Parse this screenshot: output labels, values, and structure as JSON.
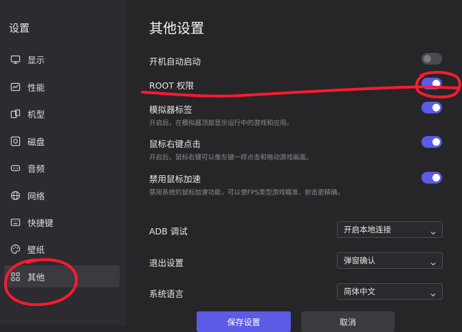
{
  "sidebar": {
    "title": "设置",
    "items": [
      {
        "label": "显示",
        "icon": "monitor-icon"
      },
      {
        "label": "性能",
        "icon": "performance-icon"
      },
      {
        "label": "机型",
        "icon": "device-icon"
      },
      {
        "label": "磁盘",
        "icon": "disk-icon"
      },
      {
        "label": "音频",
        "icon": "audio-icon"
      },
      {
        "label": "网络",
        "icon": "globe-icon"
      },
      {
        "label": "快捷键",
        "icon": "keyboard-icon"
      },
      {
        "label": "壁纸",
        "icon": "palette-icon"
      },
      {
        "label": "其他",
        "icon": "grid-icon"
      }
    ],
    "active_index": 8
  },
  "main": {
    "title": "其他设置",
    "toggles": [
      {
        "title": "开机自动启动",
        "desc": "",
        "on": false
      },
      {
        "title": "ROOT 权限",
        "desc": "",
        "on": true
      },
      {
        "title": "模拟器标签",
        "desc": "开启后，在模拟器顶部显示运行中的游戏和应用。",
        "on": true
      },
      {
        "title": "鼠标右键点击",
        "desc": "开启后，鼠标右键可以像左键一样点击和拖动游戏画面。",
        "on": true
      },
      {
        "title": "禁用鼠标加速",
        "desc": "禁用系统的鼠标加速功能，可以使FPS类型游戏瞄准、射击更精确。",
        "on": true
      }
    ],
    "selects": [
      {
        "label": "ADB 调试",
        "value": "开启本地连接"
      },
      {
        "label": "退出设置",
        "value": "弹窗确认"
      },
      {
        "label": "系统语言",
        "value": "简体中文"
      }
    ],
    "buttons": {
      "save": "保存设置",
      "cancel": "取消"
    }
  },
  "colors": {
    "accent": "#5b5be6",
    "annotation": "#ff1a2e"
  }
}
